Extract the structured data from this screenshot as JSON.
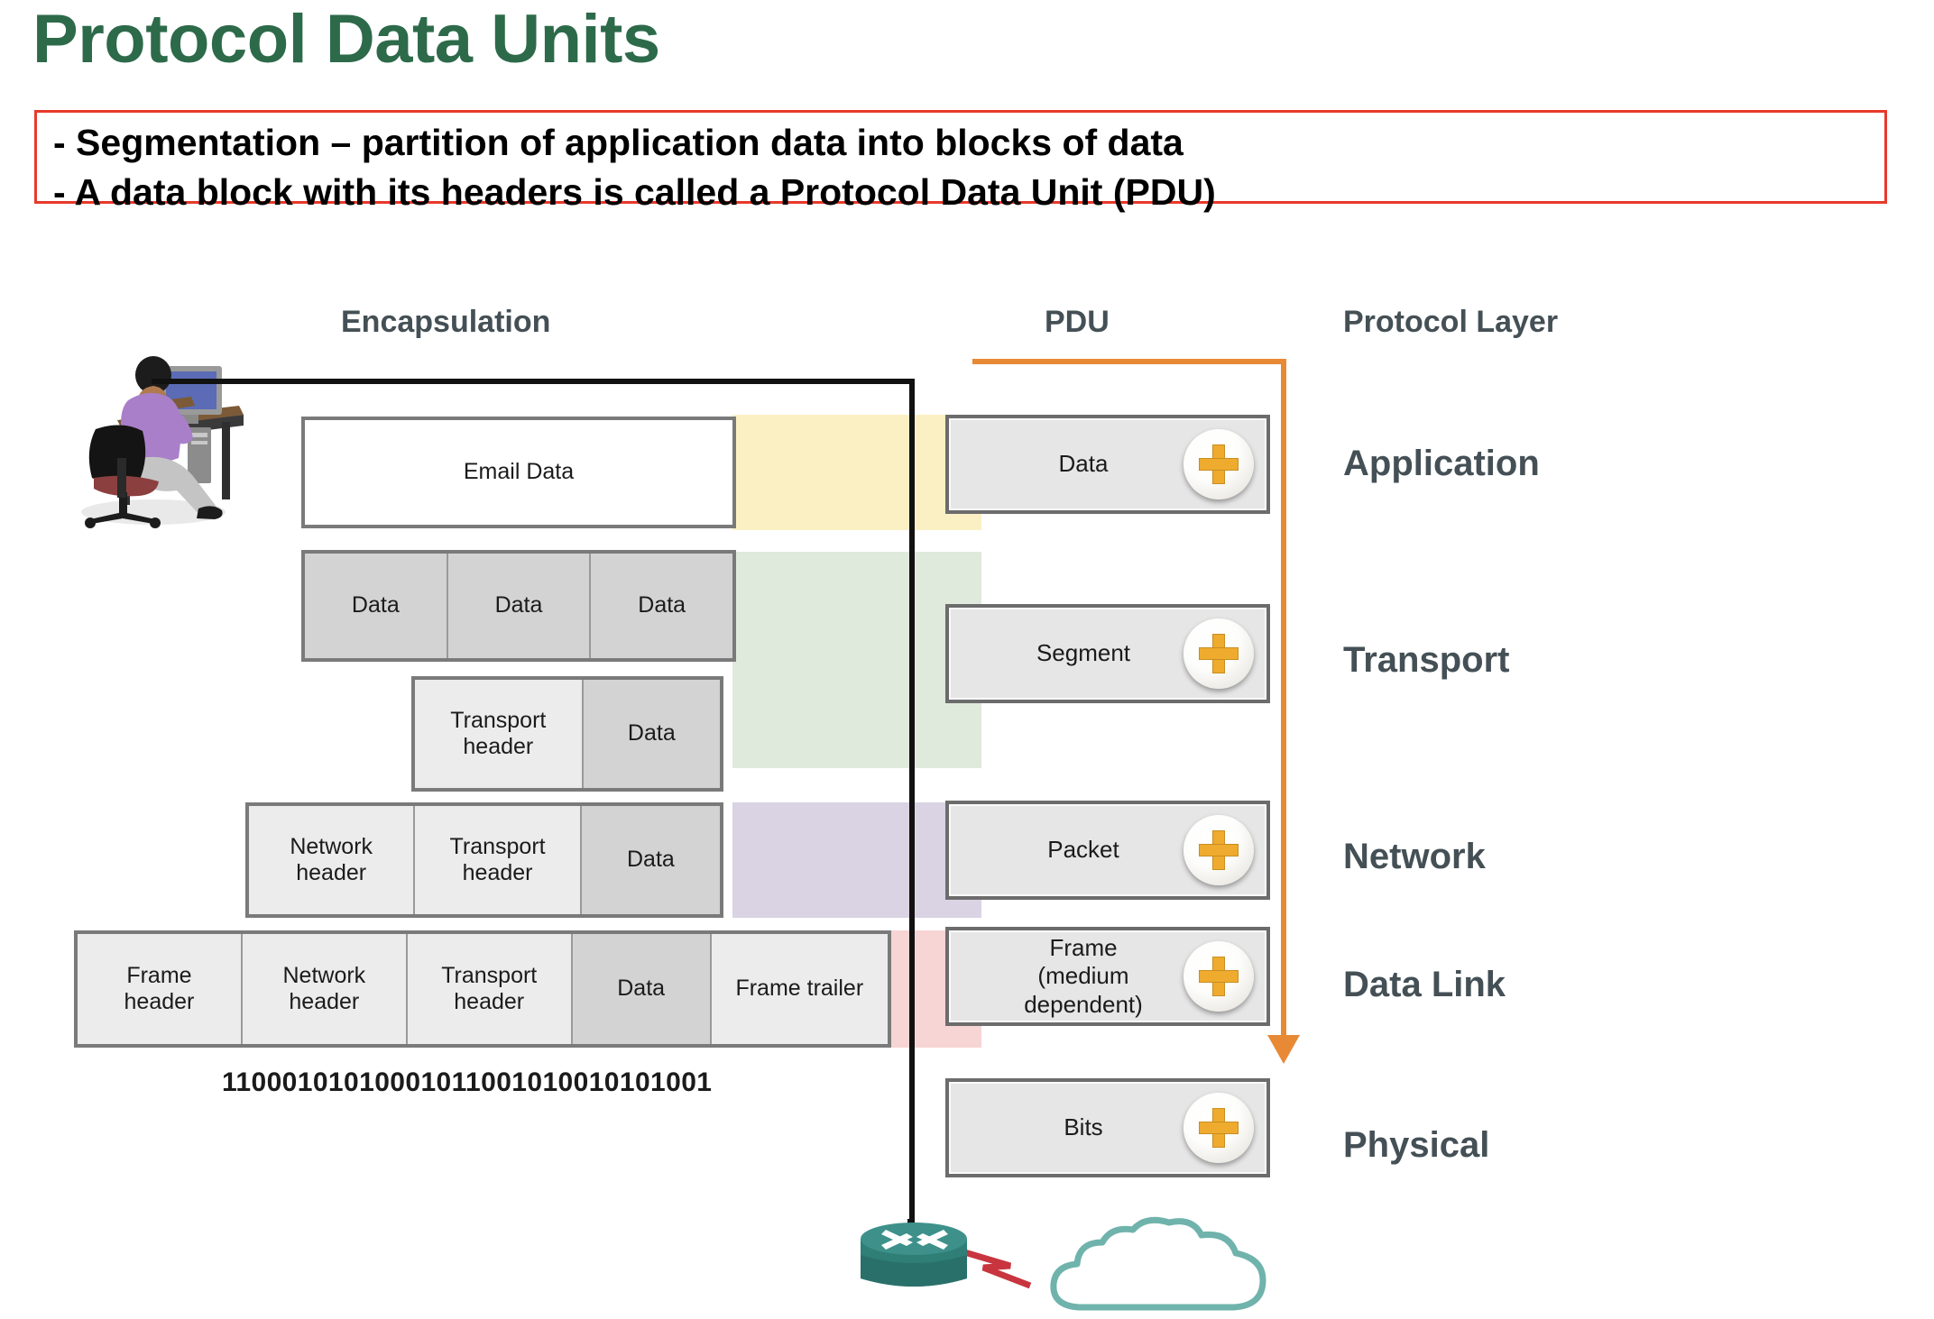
{
  "title": "Protocol Data Units",
  "callout": {
    "line1": "- Segmentation – partition of  application data into blocks of data",
    "line2": "- A data block with its headers is called a Protocol Data Unit (PDU)",
    "border_color": "#e8392b"
  },
  "columns": {
    "encapsulation": "Encapsulation",
    "pdu": "PDU",
    "protocol_layer": "Protocol Layer"
  },
  "colors": {
    "title_green": "#2d6a4a",
    "label_slate": "#445055",
    "accent_orange": "#e88a35",
    "band_application": "#fbf0c4",
    "band_transport": "#dfe9dc",
    "band_network": "#d9d3e4",
    "band_datalink": "#f6d5d4",
    "plus_gold": "#eeab2e",
    "router_teal": "#2f7f77",
    "cloud_teal": "#6fb3ac",
    "lightning_red": "#c8353f"
  },
  "encapsulation_rows": [
    {
      "name": "email-data-row",
      "cells": [
        {
          "label": "Email Data",
          "kind": "white",
          "flex": 1
        }
      ]
    },
    {
      "name": "segments-row",
      "cells": [
        {
          "label": "Data",
          "kind": "data",
          "flex": 1
        },
        {
          "label": "Data",
          "kind": "data",
          "flex": 1
        },
        {
          "label": "Data",
          "kind": "data",
          "flex": 1
        }
      ]
    },
    {
      "name": "transport-segment-row",
      "cells": [
        {
          "label": "Transport\nheader",
          "kind": "header",
          "flex": 1.22
        },
        {
          "label": "Data",
          "kind": "data",
          "flex": 1
        }
      ]
    },
    {
      "name": "network-packet-row",
      "cells": [
        {
          "label": "Network\nheader",
          "kind": "header",
          "flex": 1
        },
        {
          "label": "Transport\nheader",
          "kind": "header",
          "flex": 1
        },
        {
          "label": "Data",
          "kind": "data",
          "flex": 0.84
        }
      ]
    },
    {
      "name": "frame-row",
      "cells": [
        {
          "label": "Frame\nheader",
          "kind": "header",
          "flex": 1
        },
        {
          "label": "Network\nheader",
          "kind": "header",
          "flex": 1
        },
        {
          "label": "Transport\nheader",
          "kind": "header",
          "flex": 1
        },
        {
          "label": "Data",
          "kind": "data",
          "flex": 0.84
        },
        {
          "label": "Frame trailer",
          "kind": "trailer",
          "flex": 1.08
        }
      ]
    }
  ],
  "binary_string": "11000101010001011001010010101001",
  "pdu_boxes": [
    {
      "label": "Data",
      "icon": "plus-icon"
    },
    {
      "label": "Segment",
      "icon": "plus-icon"
    },
    {
      "label": "Packet",
      "icon": "plus-icon"
    },
    {
      "label": "Frame\n(medium\ndependent)",
      "icon": "plus-icon"
    },
    {
      "label": "Bits",
      "icon": "plus-icon"
    }
  ],
  "protocol_layers": [
    "Application",
    "Transport",
    "Network",
    "Data Link",
    "Physical"
  ],
  "icons": {
    "workstation": "workstation-icon",
    "router": "router-icon",
    "cloud": "cloud-icon",
    "lightning": "lightning-link-icon"
  }
}
